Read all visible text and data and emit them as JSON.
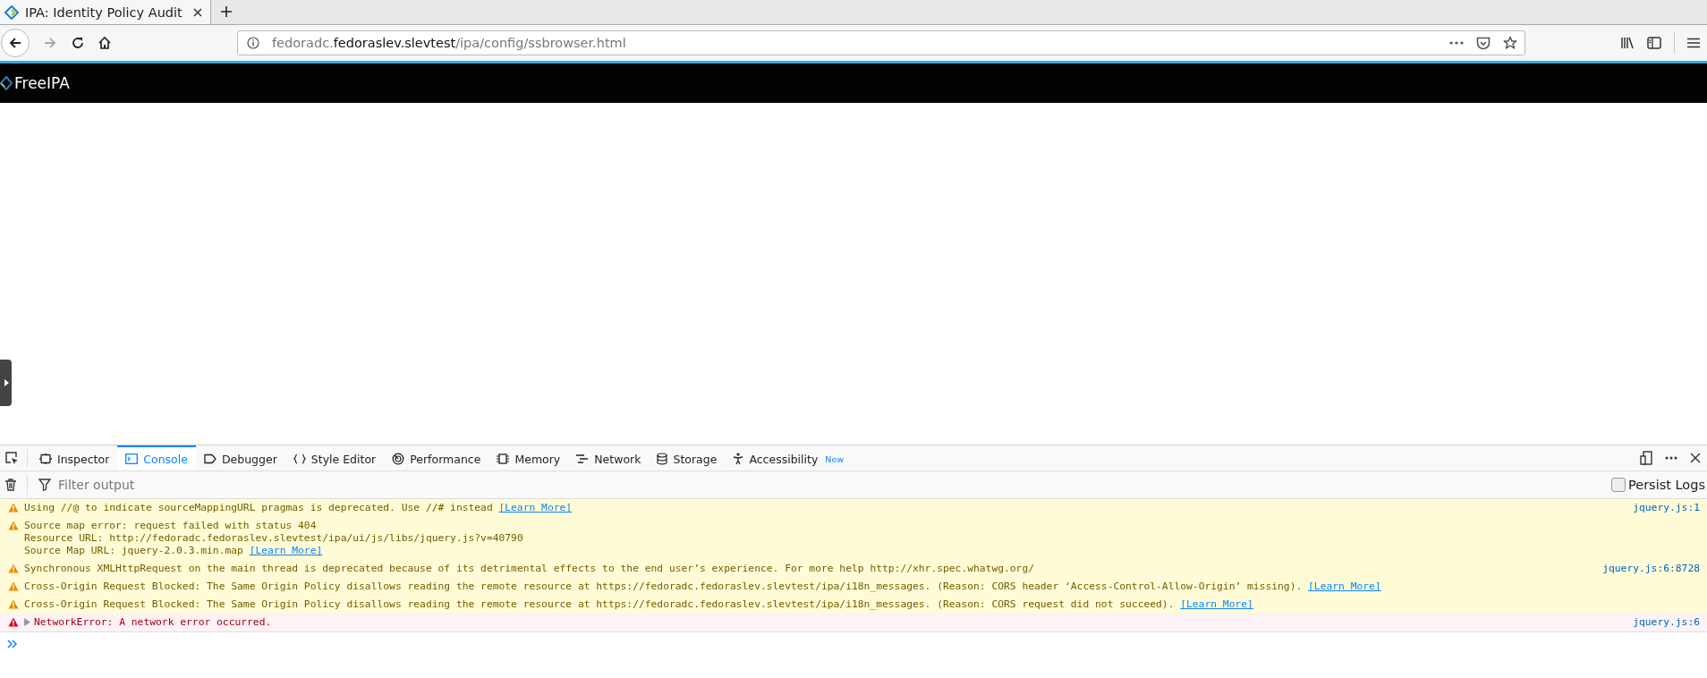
{
  "browser_tab": {
    "title": "IPA: Identity Policy Audit",
    "selected": true
  },
  "url": {
    "subdomain": "fedoradc.",
    "domain": "fedoraslev.slevtest",
    "path": "/ipa/config/ssbrowser.html"
  },
  "page": {
    "brand": "FreeIPA"
  },
  "devtools": {
    "tabs": [
      {
        "label": "Inspector",
        "selected": false
      },
      {
        "label": "Console",
        "selected": true
      },
      {
        "label": "Debugger",
        "selected": false
      },
      {
        "label": "Style Editor",
        "selected": false
      },
      {
        "label": "Performance",
        "selected": false
      },
      {
        "label": "Memory",
        "selected": false
      },
      {
        "label": "Network",
        "selected": false
      },
      {
        "label": "Storage",
        "selected": false
      },
      {
        "label": "Accessibility",
        "selected": false,
        "badge": "New"
      }
    ],
    "filter": {
      "placeholder": "Filter output"
    },
    "persist_logs": {
      "label": "Persist Logs",
      "checked": false
    },
    "messages": [
      {
        "kind": "warning",
        "lines": [
          "Using //@ to indicate sourceMappingURL pragmas is deprecated. Use //# instead"
        ],
        "link": "[Learn More]",
        "source": "jquery.js:1"
      },
      {
        "kind": "warning",
        "lines": [
          "Source map error: request failed with status 404",
          "Resource URL: http://fedoradc.fedoraslev.slevtest/ipa/ui/js/libs/jquery.js?v=40790",
          "Source Map URL: jquery-2.0.3.min.map"
        ],
        "link": "[Learn More]"
      },
      {
        "kind": "warning",
        "lines": [
          "Synchronous XMLHttpRequest on the main thread is deprecated because of its detrimental effects to the end user’s experience. For more help http://xhr.spec.whatwg.org/"
        ],
        "source": "jquery.js:6:8728"
      },
      {
        "kind": "warning",
        "lines": [
          "Cross-Origin Request Blocked: The Same Origin Policy disallows reading the remote resource at https://fedoradc.fedoraslev.slevtest/ipa/i18n_messages. (Reason: CORS header ‘Access-Control-Allow-Origin’ missing)."
        ],
        "link": "[Learn More]"
      },
      {
        "kind": "warning",
        "lines": [
          "Cross-Origin Request Blocked: The Same Origin Policy disallows reading the remote resource at https://fedoradc.fedoraslev.slevtest/ipa/i18n_messages. (Reason: CORS request did not succeed)."
        ],
        "link": "[Learn More]"
      },
      {
        "kind": "error",
        "expandable": true,
        "lines": [
          "NetworkError: A network error occurred."
        ],
        "source": "jquery.js:6"
      }
    ]
  }
}
